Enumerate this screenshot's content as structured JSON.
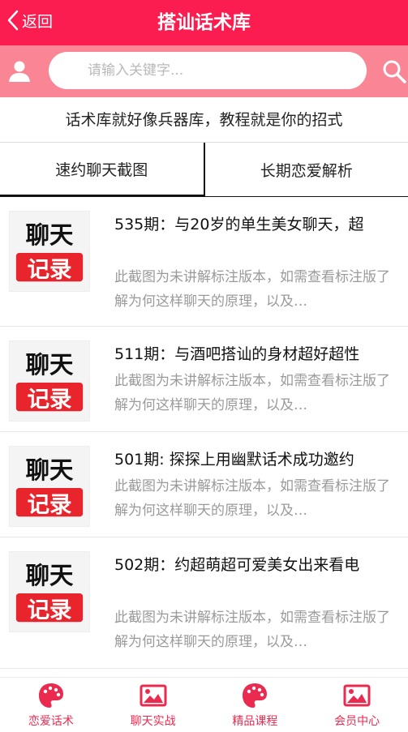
{
  "header": {
    "back_label": "返回",
    "title": "搭讪话术库"
  },
  "search": {
    "placeholder": "请输入关键字..."
  },
  "slogan": "话术库就好像兵器库，教程就是你的招式",
  "tabs": [
    {
      "label": "速约聊天截图",
      "active": true
    },
    {
      "label": "长期恋爱解析",
      "active": false
    }
  ],
  "thumbnail": {
    "line1": "聊天",
    "line2": "记录"
  },
  "items": [
    {
      "title": "535期：与20岁的单生美女聊天，超",
      "desc": "此截图为未讲解标注版本，如需查看标注版了解为何这样聊天的原理，以及…"
    },
    {
      "title": "511期：与酒吧搭讪的身材超好超性",
      "desc": "此截图为未讲解标注版本，如需查看标注版了解为何这样聊天的原理，以及…"
    },
    {
      "title": "501期: 探探上用幽默话术成功邀约",
      "desc": "此截图为未讲解标注版本，如需查看标注版了解为何这样聊天的原理，以及…"
    },
    {
      "title": "502期：约超萌超可爱美女出来看电",
      "desc": "此截图为未讲解标注版本，如需查看标注版了解为何这样聊天的原理，以及…"
    }
  ],
  "bottom_nav": [
    {
      "label": "恋爱话术",
      "icon": "palette-icon"
    },
    {
      "label": "聊天实战",
      "icon": "image-icon"
    },
    {
      "label": "精品课程",
      "icon": "palette-icon"
    },
    {
      "label": "会员中心",
      "icon": "image-icon"
    }
  ],
  "colors": {
    "brand": "#fb1d4f",
    "search_bar": "#fa8595",
    "nav": "#ea2a4f"
  }
}
